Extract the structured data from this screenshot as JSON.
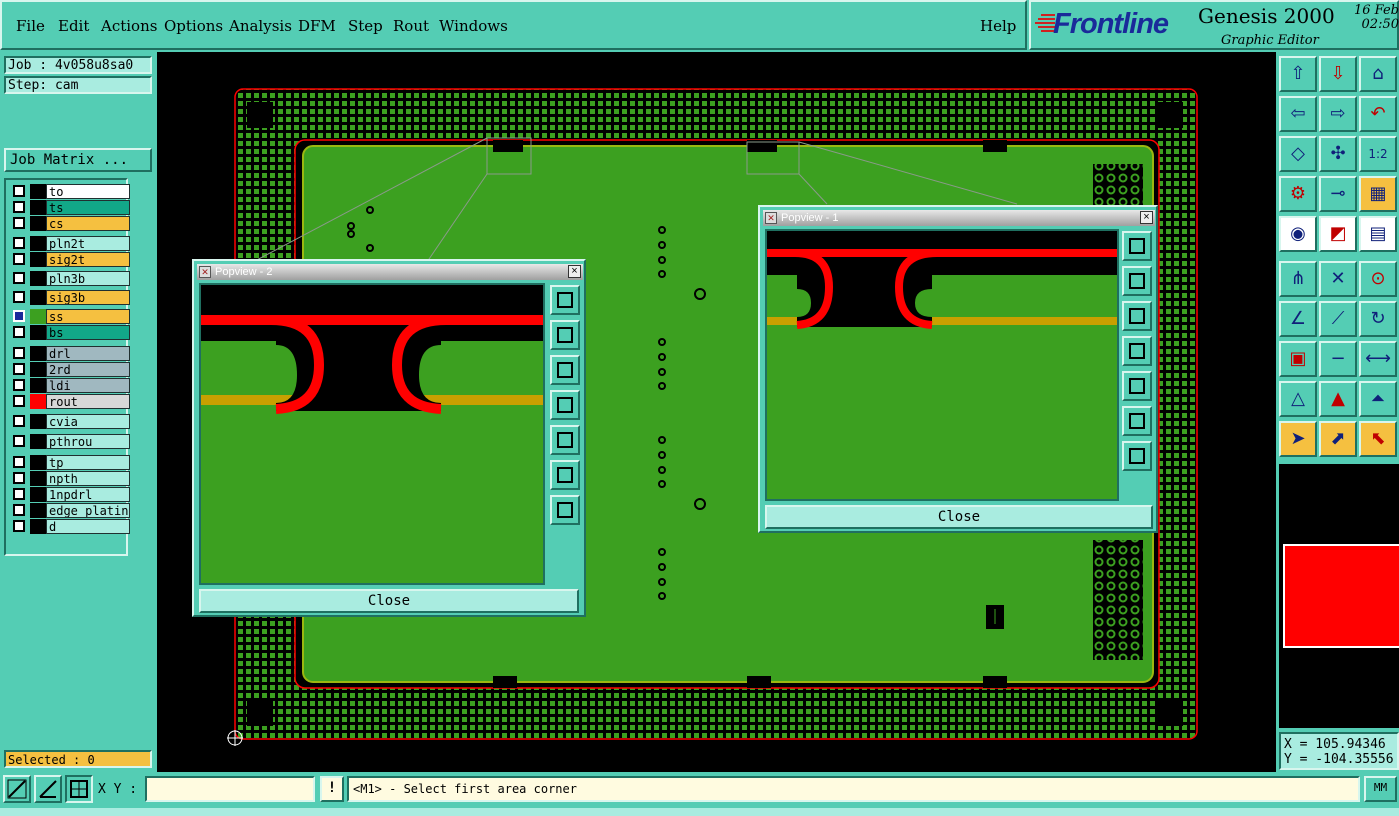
{
  "menubar": {
    "items": [
      "File",
      "Edit",
      "Actions",
      "Options",
      "Analysis",
      "DFM",
      "Step",
      "Rout",
      "Windows"
    ],
    "help": "Help"
  },
  "brand": {
    "logo": "Frontline",
    "product": "Genesis 2000",
    "subtitle": "Graphic Editor",
    "date": "16 Feb",
    "time": "02:50"
  },
  "left_panel": {
    "job": "Job : 4v058u8sa0",
    "step": "Step: cam",
    "job_matrix_label": "Job Matrix ...",
    "layers": [
      {
        "name": "to",
        "color": "#ffffff",
        "swatch": "#000000",
        "active": false
      },
      {
        "name": "ts",
        "color": "#12a888",
        "swatch": "#000000",
        "active": false
      },
      {
        "name": "cs",
        "color": "#f5c040",
        "swatch": "#000000",
        "active": false
      },
      {
        "name": "pln2t",
        "color": "#a9ece0",
        "swatch": "#000000",
        "active": false
      },
      {
        "name": "sig2t",
        "color": "#f5c040",
        "swatch": "#000000",
        "active": false
      },
      {
        "name": "pln3b",
        "color": "#a9ece0",
        "swatch": "#000000",
        "active": false
      },
      {
        "name": "sig3b",
        "color": "#f5c040",
        "swatch": "#000000",
        "active": false
      },
      {
        "name": "ss",
        "color": "#f5c040",
        "swatch": "#3ca020",
        "active": true
      },
      {
        "name": "bs",
        "color": "#12a888",
        "swatch": "#000000",
        "active": false
      },
      {
        "name": "drl",
        "color": "#a0b8c0",
        "swatch": "#000000",
        "active": false
      },
      {
        "name": "2rd",
        "color": "#a0b8c0",
        "swatch": "#000000",
        "active": false
      },
      {
        "name": "ldi",
        "color": "#a0b8c0",
        "swatch": "#000000",
        "active": false
      },
      {
        "name": "rout",
        "color": "#d8d8d8",
        "swatch": "#ff0000",
        "active": false
      },
      {
        "name": "cvia",
        "color": "#a9ece0",
        "swatch": "#000000",
        "active": false
      },
      {
        "name": "pthrou",
        "color": "#a9ece0",
        "swatch": "#000000",
        "active": false
      },
      {
        "name": "tp",
        "color": "#a9ece0",
        "swatch": "#000000",
        "active": false
      },
      {
        "name": "npth",
        "color": "#a9ece0",
        "swatch": "#000000",
        "active": false
      },
      {
        "name": "1npdrl",
        "color": "#a9ece0",
        "swatch": "#000000",
        "active": false
      },
      {
        "name": "edge_plating",
        "color": "#a9ece0",
        "swatch": "#000000",
        "active": false
      },
      {
        "name": "d",
        "color": "#a9ece0",
        "swatch": "#000000",
        "active": false
      }
    ],
    "selected": "Selected : 0"
  },
  "popview1": {
    "title": "Popview - 1",
    "close_label": "Close"
  },
  "popview2": {
    "title": "Popview - 2",
    "close_label": "Close"
  },
  "right_panel": {
    "tool_icons": [
      "move-up-icon",
      "move-down-icon",
      "home-icon",
      "pan-left-icon",
      "pan-right-icon",
      "undo-zoom-icon",
      "fit-all-icon",
      "fit-profile-icon",
      "zoom-1to2-icon",
      "settings-icon",
      "measure-icon",
      "layer-display-icon",
      "snap-icon",
      "draw-icon",
      "ruler-icon",
      "connect-icon",
      "cross-icon",
      "node-icon",
      "line-icon",
      "arc-icon",
      "rotate-icon",
      "select-box-icon",
      "minus-icon",
      "resize-icon",
      "triangle-icon",
      "triangle-up-icon",
      "triangle-outline-icon",
      "pointer-icon",
      "pointer-frame-icon",
      "pointer-hex-icon"
    ],
    "x_coord": "X = 105.94346",
    "y_coord": "Y = -104.35556"
  },
  "bottom_bar": {
    "xy_label": "X Y :",
    "xy_value": "",
    "prompt": "<M1> - Select first area corner",
    "units": "MM",
    "excl": "!"
  }
}
